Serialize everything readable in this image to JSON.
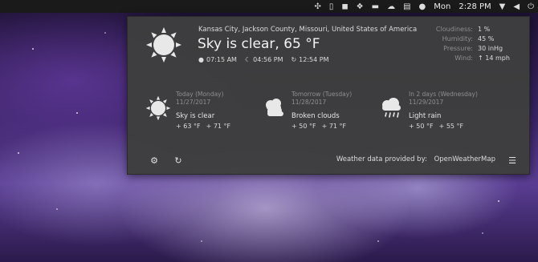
{
  "topbar": {
    "day": "Mon",
    "time": "2:28 PM",
    "icons": [
      "network-icon",
      "phone-icon",
      "bag-icon",
      "dropbox-icon",
      "folder-icon",
      "cloud-icon",
      "clipboard-icon",
      "record-icon",
      "wifi-icon",
      "volume-icon",
      "power-icon"
    ]
  },
  "weather": {
    "location": "Kansas City, Jackson County, Missouri, United States of America",
    "condition": "Sky is clear, 65 °F",
    "sunrise": "07:15 AM",
    "sunset": "04:56 PM",
    "updated": "12:54 PM",
    "details": [
      {
        "key": "Cloudiness:",
        "value": "1 %"
      },
      {
        "key": "Humidity:",
        "value": "45 %"
      },
      {
        "key": "Pressure:",
        "value": "30 inHg"
      },
      {
        "key": "Wind:",
        "value": "↑ 14 mph"
      }
    ],
    "forecast": [
      {
        "day": "Today (Monday)",
        "date": "11/27/2017",
        "desc": "Sky is clear",
        "low": "+ 63 °F",
        "high": "+ 71 °F",
        "icon": "sun-icon"
      },
      {
        "day": "Tomorrow (Tuesday)",
        "date": "11/28/2017",
        "desc": "Broken clouds",
        "low": "+ 50 °F",
        "high": "+ 71 °F",
        "icon": "broken-clouds-icon"
      },
      {
        "day": "In 2 days (Wednesday)",
        "date": "11/29/2017",
        "desc": "Light rain",
        "low": "+ 50 °F",
        "high": "+ 55 °F",
        "icon": "rain-icon"
      }
    ],
    "provider_label": "Weather data provided by:",
    "provider_link": "OpenWeatherMap"
  }
}
